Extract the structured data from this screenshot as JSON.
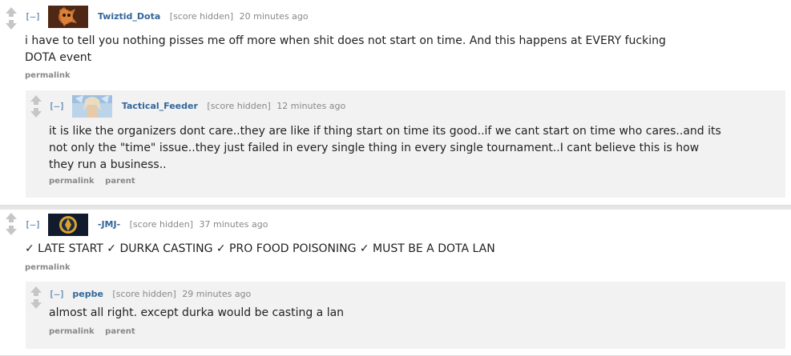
{
  "comments": [
    {
      "toggle": "[–]",
      "avatar": "twiztid-dota-avatar",
      "author": "Twiztid_Dota",
      "score": "[score hidden]",
      "time": "20 minutes ago",
      "body": "i have to tell you nothing pisses me off more when shit does not start on time. And this happens at EVERY fucking DOTA event",
      "links": [
        "permalink"
      ],
      "replies": [
        {
          "toggle": "[–]",
          "avatar": "tactical-feeder-avatar",
          "author": "Tactical_Feeder",
          "score": "[score hidden]",
          "time": "12 minutes ago",
          "body": "it is like the organizers dont care..they are like if thing start on time its good..if we cant start on time who cares..and its not only the \"time\" issue..they just failed in every single thing in every single tournament..I cant believe this is how they run a business..",
          "links": [
            "permalink",
            "parent"
          ]
        }
      ]
    },
    {
      "toggle": "[–]",
      "avatar": "jmj-avatar",
      "author": "-JMJ-",
      "score": "[score hidden]",
      "time": "37 minutes ago",
      "body": "✓ LATE START ✓ DURKA CASTING ✓ PRO FOOD POISONING ✓ MUST BE A DOTA LAN",
      "links": [
        "permalink"
      ],
      "replies": [
        {
          "toggle": "[–]",
          "author": "pepbe",
          "score": "[score hidden]",
          "time": "29 minutes ago",
          "body": "almost all right. except durka would be casting a lan",
          "links": [
            "permalink",
            "parent"
          ]
        }
      ]
    }
  ],
  "colors": {
    "author": "#336699",
    "meta": "#888888",
    "reply_background": "#f2f2f2",
    "page_background": "#e6e6e6"
  }
}
